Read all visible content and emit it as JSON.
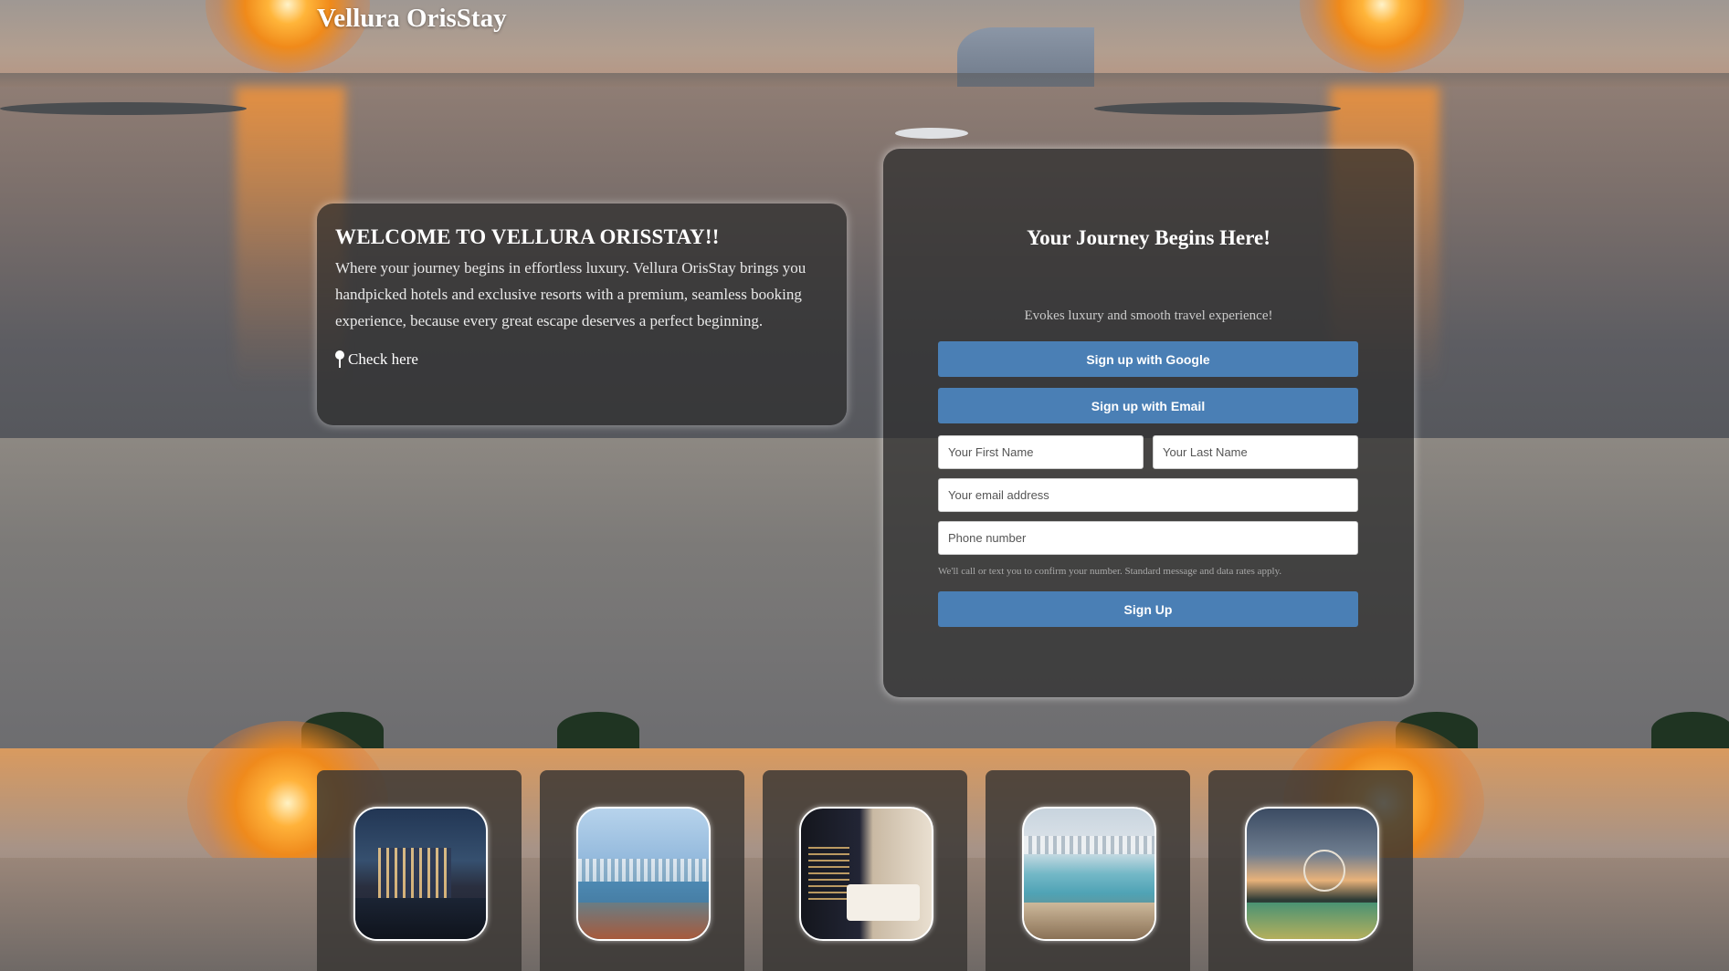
{
  "brand": {
    "name": "Vellura OrisStay"
  },
  "welcome": {
    "title": "WELCOME TO VELLURA ORISSTAY!!",
    "body": "Where your journey begins in effortless luxury. Vellura OrisStay brings you handpicked hotels and exclusive resorts with a premium, seamless booking experience, because every great escape deserves a perfect beginning.",
    "check_link": "Check here",
    "check_icon": "location-pin-icon"
  },
  "signup": {
    "title": "Your Journey Begins Here!",
    "tagline": "Evokes luxury and smooth travel experience!",
    "google_button": "Sign up with Google",
    "email_button": "Sign up with Email",
    "first_name_placeholder": "Your First Name",
    "last_name_placeholder": "Your Last Name",
    "email_placeholder": "Your email address",
    "phone_placeholder": "Phone number",
    "disclaimer": "We'll call or text you to confirm your number. Standard message and data rates apply.",
    "submit_button": "Sign Up"
  },
  "gallery": {
    "items": [
      {
        "subject": "city-skyline-night-view"
      },
      {
        "subject": "marina-balcony-view"
      },
      {
        "subject": "hotel-bedroom-night"
      },
      {
        "subject": "rooftop-pool-terrace"
      },
      {
        "subject": "resort-pool-at-dusk"
      }
    ]
  },
  "colors": {
    "accent_button": "#4a7fb5",
    "card_background": "rgba(45,45,45,0.72)",
    "text_primary": "#ffffff",
    "sunset_orange": "#f08a1a"
  }
}
